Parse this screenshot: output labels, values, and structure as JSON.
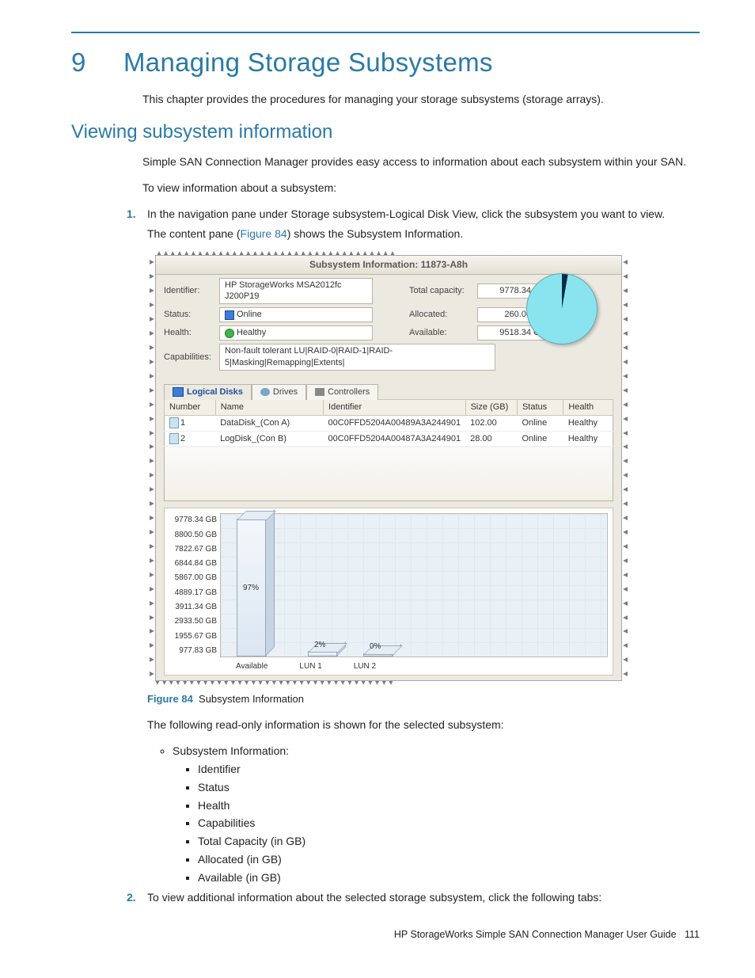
{
  "chapter": {
    "number": "9",
    "title": "Managing Storage Subsystems"
  },
  "intro": "This chapter provides the procedures for managing your storage subsystems (storage arrays).",
  "section": "Viewing subsystem information",
  "p1": "Simple SAN Connection Manager provides easy access to information about each subsystem within your SAN.",
  "p2": "To view information about a subsystem:",
  "step1": "In the navigation pane under Storage subsystem-Logical Disk View, click the subsystem you want to view.",
  "step1b_pre": "The content pane (",
  "step1b_link": "Figure 84",
  "step1b_post": ") shows the Subsystem Information.",
  "fig": {
    "label": "Figure 84",
    "caption": "Subsystem Information"
  },
  "after_fig": "The following read-only information is shown for the selected subsystem:",
  "bullets_head": "Subsystem Information:",
  "bullets_items": {
    "a": "Identifier",
    "b": "Status",
    "c": "Health",
    "d": "Capabilities",
    "e": "Total Capacity (in GB)",
    "f": "Allocated (in GB)",
    "g": "Available (in GB)"
  },
  "step2": "To view additional information about the selected storage subsystem, click the following tabs:",
  "footer": {
    "title": "HP StorageWorks Simple SAN Connection Manager User Guide",
    "page": "111"
  },
  "win": {
    "title": "Subsystem Information: 11873-A8h",
    "labels": {
      "identifier": "Identifier:",
      "status": "Status:",
      "health": "Health:",
      "capabilities": "Capabilities:",
      "total": "Total capacity:",
      "allocated": "Allocated:",
      "available": "Available:"
    },
    "values": {
      "identifier": "HP StorageWorks MSA2012fc J200P19",
      "status": "Online",
      "health": "Healthy",
      "capabilities": "Non-fault tolerant LU|RAID-0|RAID-1|RAID-5|Masking|Remapping|Extents|",
      "total": "9778.34 GB",
      "allocated": "260.00 GB",
      "available": "9518.34 GB"
    },
    "tabs": {
      "ld": "Logical Disks",
      "dr": "Drives",
      "ct": "Controllers"
    },
    "table": {
      "headers": {
        "number": "Number",
        "name": "Name",
        "identifier": "Identifier",
        "size": "Size (GB)",
        "status": "Status",
        "health": "Health"
      },
      "rows": [
        {
          "num": "1",
          "name": "DataDisk_(Con A)",
          "ident": "00C0FFD5204A00489A3A244901",
          "size": "102.00",
          "status": "Online",
          "health": "Healthy"
        },
        {
          "num": "2",
          "name": "LogDisk_(Con B)",
          "ident": "00C0FFD5204A00487A3A244901",
          "size": "28.00",
          "status": "Online",
          "health": "Healthy"
        }
      ]
    }
  },
  "chart_data": {
    "type": "bar",
    "title": "",
    "xlabel": "",
    "ylabel": "",
    "ylim": [
      0,
      9778.34
    ],
    "y_ticks": [
      "9778.34 GB",
      "8800.50 GB",
      "7822.67 GB",
      "6844.84 GB",
      "5867.00 GB",
      "4889.17 GB",
      "3911.34 GB",
      "2933.50 GB",
      "1955.67 GB",
      "977.83 GB"
    ],
    "categories": [
      "Available",
      "LUN 1",
      "LUN 2"
    ],
    "values_pct": [
      97,
      2,
      0
    ],
    "pct_labels": [
      "97%",
      "2%",
      "0%"
    ]
  }
}
